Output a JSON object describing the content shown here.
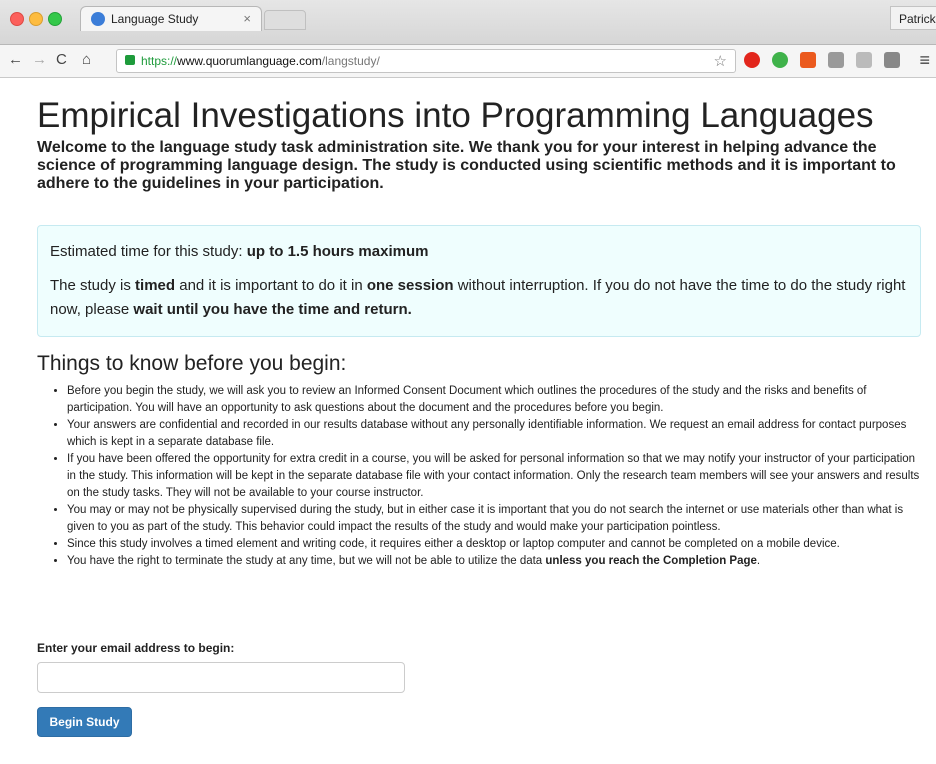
{
  "browser": {
    "tab_title": "Language Study",
    "tab_close": "×",
    "profile_name": "Patrick",
    "url_scheme": "https://",
    "url_host": "www.quorumlanguage.com",
    "url_path": "/langstudy/",
    "icons": [
      "back-icon",
      "forward-icon",
      "reload-icon",
      "home-icon",
      "lock-icon",
      "star-icon",
      "opera-icon",
      "evernote-icon",
      "office-icon",
      "extension-icon",
      "cube-icon",
      "drive-icon",
      "menu-icon"
    ]
  },
  "page": {
    "title": "Empirical Investigations into Programming Languages",
    "intro": "Welcome to the language study task administration site. We thank you for your interest in helping advance the science of programming language design. The study is conducted using scientific methods and it is important to adhere to the guidelines in your participation.",
    "alert": {
      "time_prefix": "Estimated time for this study: ",
      "time_value": "up to 1.5 hours maximum",
      "line2_a": "The study is ",
      "line2_b": "timed",
      "line2_c": " and it is important to do it in ",
      "line2_d": "one session",
      "line2_e": " without interruption. If you do not have the time to do the study right now, please ",
      "line2_f": "wait until you have the time and return."
    },
    "section_title": "Things to know before you begin:",
    "rules": [
      "Before you begin the study, we will ask you to review an Informed Consent Document which outlines the procedures of the study and the risks and benefits of participation. You will have an opportunity to ask questions about the document and the procedures before you begin.",
      "Your answers are confidential and recorded in our results database without any personally identifiable information. We request an email address for contact purposes which is kept in a separate database file.",
      "If you have been offered the opportunity for extra credit in a course, you will be asked for personal information so that we may notify your instructor of your participation in the study. This information will be kept in the separate database file with your contact information. Only the research team members will see your answers and results on the study tasks. They will not be available to your course instructor.",
      "You may or may not be physically supervised during the study, but in either case it is important that you do not search the internet or use materials other than what is given to you as part of the study. This behavior could impact the results of the study and would make your participation pointless.",
      "Since this study involves a timed element and writing code, it requires either a desktop or laptop computer and cannot be completed on a mobile device."
    ],
    "last_rule_a": "You have the right to terminate the study at any time, but we will not be able to utilize the data ",
    "last_rule_b": "unless you reach the Completion Page",
    "last_rule_c": ".",
    "email_label": "Enter your email address to begin:",
    "email_value": "",
    "button_label": "Begin Study"
  }
}
